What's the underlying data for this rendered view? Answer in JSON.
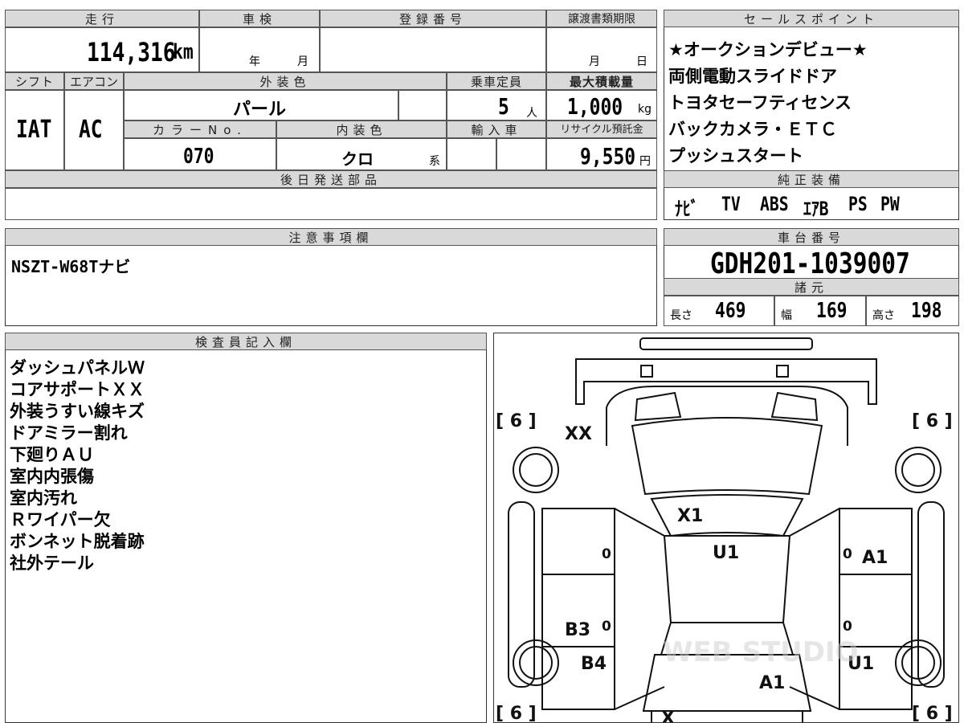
{
  "vehicle": {
    "mileage_label": "走行",
    "mileage_value": "114,316",
    "mileage_unit": "km",
    "inspection_label": "車検",
    "inspection_year_unit": "年",
    "inspection_month_unit": "月",
    "registration_label": "登録番号",
    "transfer_label": "譲渡書類期限",
    "transfer_month_unit": "月",
    "transfer_day_unit": "日",
    "shift_label": "シフト",
    "shift_value": "IAT",
    "ac_label": "エアコン",
    "ac_value": "AC",
    "exterior_color_label": "外装色",
    "exterior_color_value": "パール",
    "capacity_label": "乗車定員",
    "capacity_value": "5",
    "capacity_unit": "人",
    "max_load_label": "最大積載量",
    "max_load_value": "1,000",
    "max_load_unit": "kg",
    "color_no_label": "カラーNo.",
    "color_no_value": "070",
    "interior_color_label": "内装色",
    "interior_color_value": "クロ",
    "interior_color_suffix": "系",
    "import_label": "輸入車",
    "recycle_label": "リサイクル預託金",
    "recycle_value": "9,550",
    "recycle_unit": "円",
    "later_parts_label": "後日発送部品"
  },
  "sales_points": {
    "label": "セールスポイント",
    "lines": [
      "★オークションデビュー★",
      "両側電動スライドドア",
      "トヨタセーフティセンス",
      "バックカメラ・ＥＴＣ",
      "プッシュスタート"
    ]
  },
  "equipment": {
    "label": "純正装備",
    "items": [
      "ﾅﾋﾞ",
      "TV",
      "ABS",
      "ｴｱB",
      "PS",
      "PW"
    ]
  },
  "notes": {
    "label": "注意事項欄",
    "text": "NSZT-W68Tナビ"
  },
  "chassis": {
    "label": "車台番号",
    "value": "GDH201-1039007"
  },
  "specs": {
    "label": "諸元",
    "length_label": "長さ",
    "length_value": "469",
    "width_label": "幅",
    "width_value": "169",
    "height_label": "高さ",
    "height_value": "198"
  },
  "inspector": {
    "label": "検査員記入欄",
    "lines": [
      "ダッシュパネルＷ",
      "コアサポートＸＸ",
      "外装うすい線キズ",
      "ドアミラー割れ",
      "下廻りＡＵ",
      "室内内張傷",
      "室内汚れ",
      "Ｒワイパー欠",
      "ボンネット脱着跡",
      "社外テール"
    ]
  },
  "diagram": {
    "tire_fl": "[ 6 ]",
    "tire_fr": "[ 6 ]",
    "tire_rl": "[ 6 ]",
    "tire_rr": "[ 6 ]",
    "front_left": "XX",
    "hood": "X1",
    "roof": "U1",
    "right_front_door": "A1",
    "left_rear_door": "B3",
    "left_rear_quarter": "B4",
    "right_rear": "U1",
    "rear": "A1",
    "bottom": "X",
    "zero_1": "0",
    "zero_2": "0",
    "zero_3": "0",
    "zero_4": "0",
    "watermark": "WEB STUDIO"
  }
}
